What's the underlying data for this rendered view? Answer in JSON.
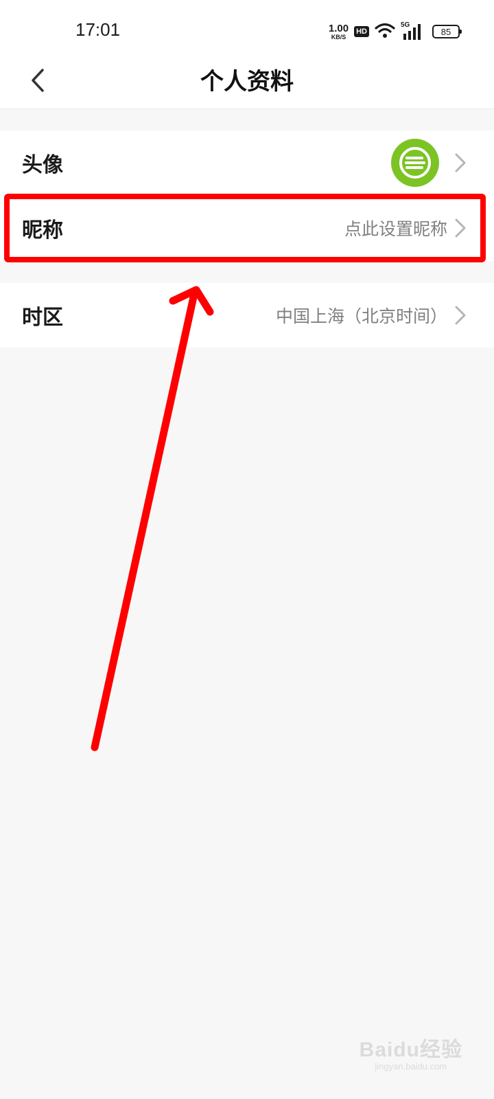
{
  "status_bar": {
    "time": "17:01",
    "net_speed_value": "1.00",
    "net_speed_unit": "KB/S",
    "hd_badge": "HD",
    "signal_label": "5G",
    "battery_level": "85"
  },
  "header": {
    "title": "个人资料"
  },
  "rows": {
    "avatar": {
      "label": "头像"
    },
    "nickname": {
      "label": "昵称",
      "value": "点此设置昵称"
    },
    "timezone": {
      "label": "时区",
      "value": "中国上海（北京时间）"
    }
  },
  "icons": {
    "back": "chevron-left-icon",
    "chevron": "chevron-right-icon",
    "avatar": "default-avatar-icon",
    "wifi": "wifi-icon",
    "signal": "signal-bars-icon",
    "battery": "battery-icon"
  },
  "colors": {
    "avatar_green": "#7cc324",
    "highlight_red": "#ff0000",
    "background": "#f7f7f7"
  },
  "watermark": {
    "brand": "Baidu经验",
    "url": "jingyan.baidu.com"
  }
}
